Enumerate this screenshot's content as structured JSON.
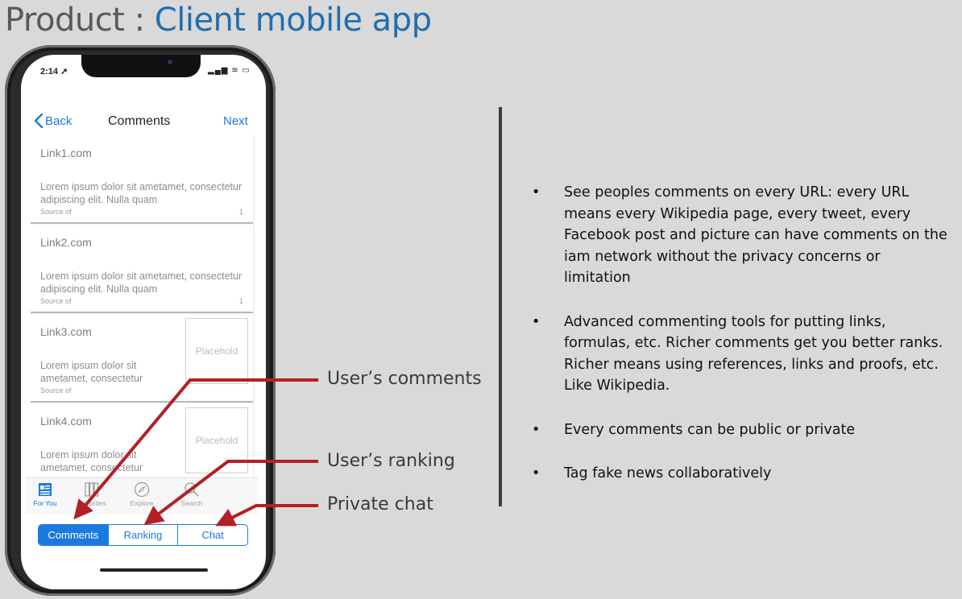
{
  "title": {
    "prefix": "Product : ",
    "accent": "Client mobile app"
  },
  "phone": {
    "status": {
      "time": "2:14 ➚",
      "icons": "▂▄▆ ≋ ▭"
    },
    "nav": {
      "back": "Back",
      "title": "Comments",
      "next": "Next"
    },
    "cards": [
      {
        "link": "Link1.com",
        "body": "Lorem ipsum dolor sit ametamet, consectetur adipiscing elit. Nulla quam",
        "source": "Source of",
        "count": "1"
      },
      {
        "link": "Link2.com",
        "body": "Lorem ipsum dolor sit ametamet, consectetur adipiscing elit. Nulla quam",
        "source": "Source of",
        "count": "1"
      },
      {
        "link": "Link3.com",
        "body": "Lorem ipsum dolor sit ametamet, consectetur",
        "source": "Source of",
        "placeholder": "Placehold"
      },
      {
        "link": "Link4.com",
        "body": "Lorem ipsum dolor sit ametamet, consectetur",
        "placeholder": "Placehold"
      }
    ],
    "tabs": [
      {
        "label": "For You",
        "icon": "news-icon"
      },
      {
        "label": "Favorites",
        "icon": "grid-icon"
      },
      {
        "label": "Explore",
        "icon": "compass-icon"
      },
      {
        "label": "Search",
        "icon": "search-icon"
      }
    ],
    "segments": [
      "Comments",
      "Ranking",
      "Chat"
    ]
  },
  "annotations": {
    "comments": "User’s comments",
    "ranking": "User’s ranking",
    "chat": "Private chat"
  },
  "bullets": [
    "See peoples comments on every URL: every URL means every Wikipedia page, every tweet, every Facebook post and picture can have comments on the iam network without the privacy concerns or limitation",
    "Advanced commenting tools for putting links, formulas, etc. Richer comments get you better ranks. Richer means using references, links and proofs, etc. Like Wikipedia.",
    "Every comments can be public or private",
    "Tag fake news collaboratively"
  ],
  "colors": {
    "accent": "#1f6fb2",
    "ios_blue": "#1a7ae0",
    "arrow_red": "#b22025",
    "background": "#d9d9d9"
  }
}
